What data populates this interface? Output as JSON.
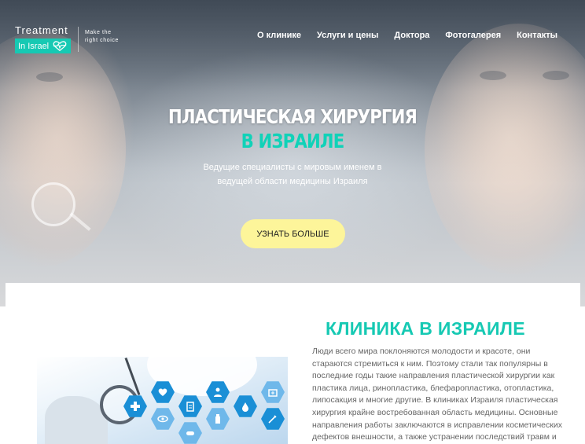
{
  "logo": {
    "top": "Treatment",
    "badge": "In Israel",
    "tagline": "Make the right choice"
  },
  "nav": {
    "items": [
      "О клинике",
      "Услуги и цены",
      "Доктора",
      "Фотогалерея",
      "Контакты"
    ]
  },
  "hero": {
    "title_line1": "ПЛАСТИЧЕСКАЯ ХИРУРГИЯ",
    "title_line2": "В ИЗРАИЛЕ",
    "subtitle": "Ведущие специалисты с мировым именем в ведущей области медицины Израиля",
    "cta": "УЗНАТЬ БОЛЬШЕ"
  },
  "clinic": {
    "title": "КЛИНИКА В ИЗРАИЛЕ",
    "text": "Люди всего мира поклоняются молодости и красоте, они стараются стремиться к ним. Поэтому стали так популярны в последние годы такие направления пластической хирургии как пластика лица, ринопластика, блефаропластика, отопластика, липосакция и многие другие. В клиниках Израиля пластическая хирургия крайне востребованная область медицины. Основные направления работы заключаются в исправлении косметических дефектов внешности, а также устранении последствий травм и"
  },
  "colors": {
    "accent": "#16c9b3",
    "cta_bg": "#fdf59a",
    "icon_blue": "#1a8fd6"
  }
}
